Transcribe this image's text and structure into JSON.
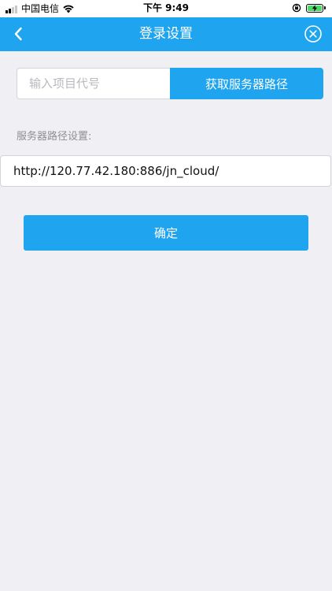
{
  "status_bar": {
    "carrier": "中国电信",
    "time": "下午 9:49",
    "battery_color": "#4cd964"
  },
  "nav": {
    "title": "登录设置",
    "back_icon": "chevron-left-icon",
    "close_icon": "close-circle-icon",
    "background": "#1fa5ef"
  },
  "project": {
    "code_value": "",
    "code_placeholder": "输入项目代号",
    "fetch_label": "获取服务器路径"
  },
  "server": {
    "label": "服务器路径设置:",
    "path_value": "http://120.77.42.180:886/jn_cloud/"
  },
  "confirm_label": "确定",
  "theme": {
    "accent": "#1fa5ef",
    "page_background": "#efeff4"
  }
}
